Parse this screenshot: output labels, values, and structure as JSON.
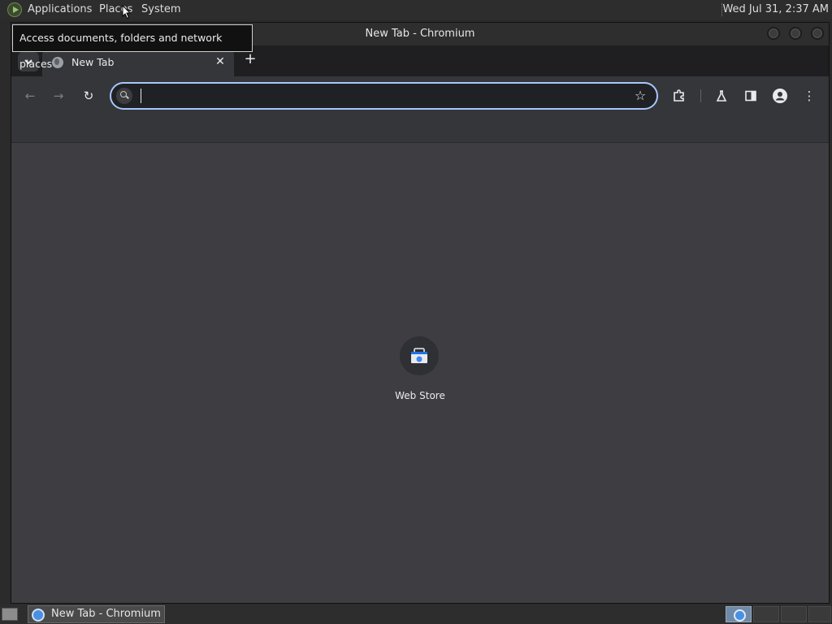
{
  "top_panel": {
    "applications_label": "Applications",
    "places_label": "Places",
    "system_label": "System",
    "clock": "Wed Jul 31,  2:37 AM"
  },
  "tooltip": {
    "text": "Access documents, folders and network places"
  },
  "window": {
    "title": "New Tab - Chromium",
    "tab": {
      "title": "New Tab",
      "close_glyph": "✕"
    },
    "new_tab_glyph": "+",
    "tab_search_glyph": "⌄",
    "toolbar": {
      "back_glyph": "←",
      "forward_glyph": "→",
      "reload_glyph": "↻",
      "bookmark_glyph": "☆",
      "menu_glyph": "⋮",
      "omnibox_value": ""
    },
    "shortcuts": [
      {
        "label": "Web Store",
        "icon": "web-store-icon"
      }
    ]
  },
  "taskbar": {
    "items": [
      {
        "label": "New Tab - Chromium",
        "icon": "chromium-icon"
      }
    ]
  },
  "colors": {
    "accent": "#a8c7fa",
    "content_bg": "#3e3e42",
    "toolbar_bg": "#35363a"
  }
}
